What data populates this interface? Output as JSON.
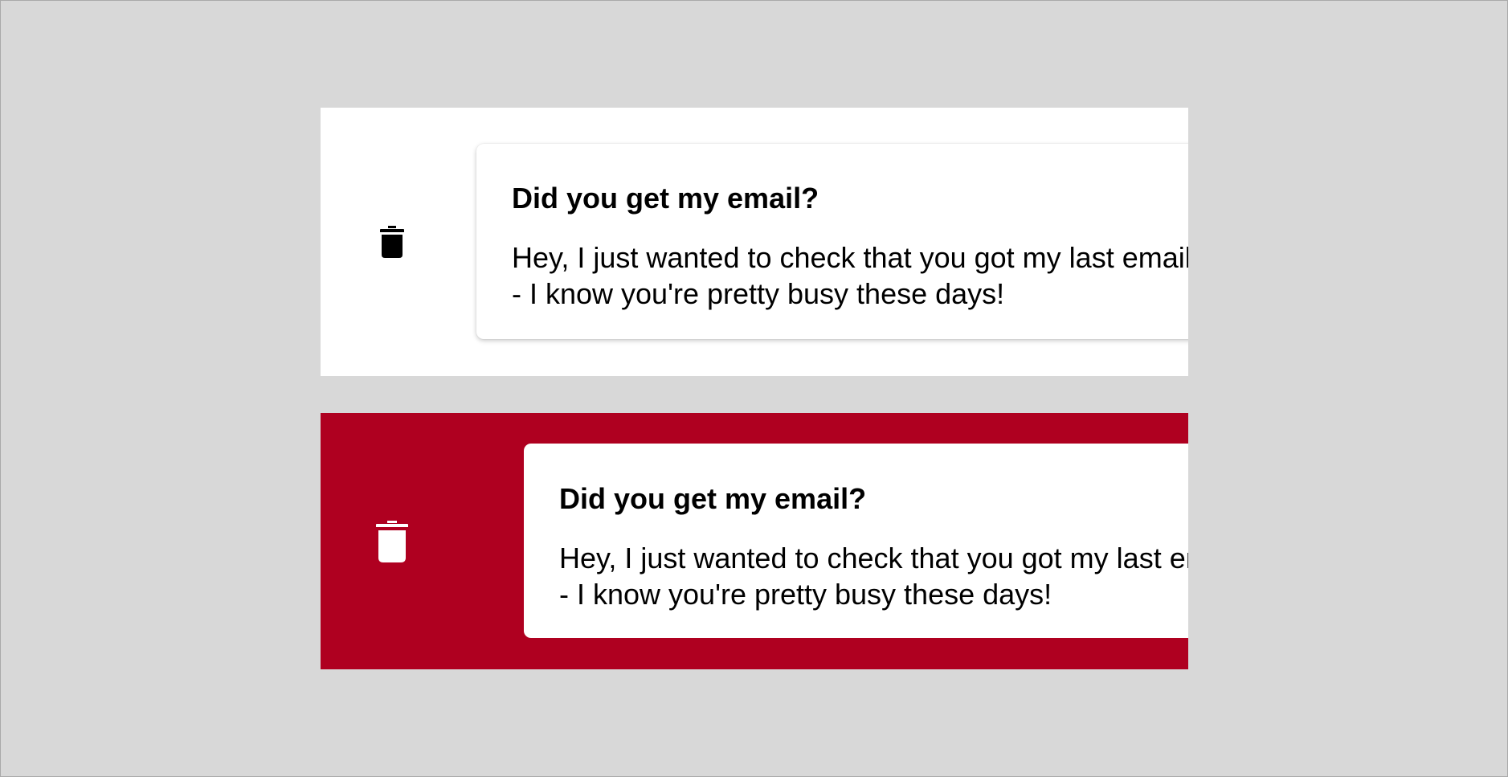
{
  "colors": {
    "page_background": "#d8d8d8",
    "resting_background": "#ffffff",
    "delete_active_background": "#af0020",
    "card_background": "#ffffff"
  },
  "rows": [
    {
      "state": "swiping",
      "action_icon": "trash-icon",
      "icon_color": "#000000",
      "title": "Did you get my email?",
      "body_line_1": "Hey, I just wanted to check that you got my last email",
      "body_line_2": "- I know you're pretty busy these days!"
    },
    {
      "state": "delete-threshold-reached",
      "action_icon": "trash-icon",
      "icon_color": "#ffffff",
      "title": "Did you get my email?",
      "body_line_1": "Hey, I just wanted to check that you got my last email",
      "body_line_2": "- I know you're pretty busy these days!"
    }
  ]
}
